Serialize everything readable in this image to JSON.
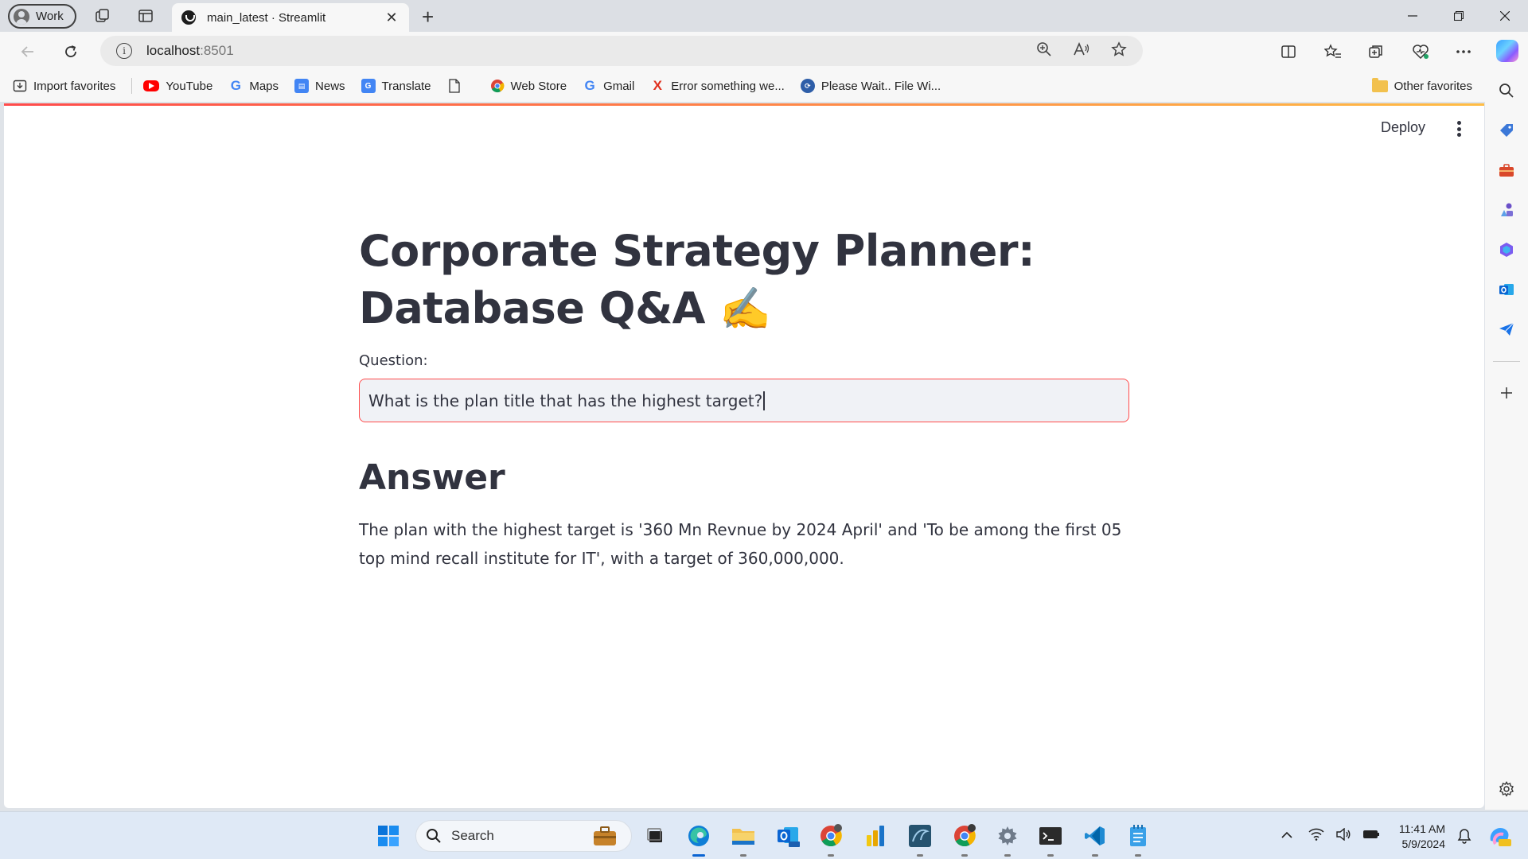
{
  "browser": {
    "profile_label": "Work",
    "tab_title": "main_latest · Streamlit",
    "tab_close": "✕",
    "new_tab": "+",
    "url_host": "localhost",
    "url_port": ":8501"
  },
  "favorites": {
    "items": [
      {
        "label": "Import favorites"
      },
      {
        "label": "YouTube"
      },
      {
        "label": "Maps"
      },
      {
        "label": "News"
      },
      {
        "label": "Translate"
      },
      {
        "label": ""
      },
      {
        "label": "Web Store"
      },
      {
        "label": "Gmail"
      },
      {
        "label": "Error something we..."
      },
      {
        "label": "Please Wait.. File Wi..."
      }
    ],
    "other": "Other favorites"
  },
  "app": {
    "deploy_label": "Deploy",
    "title_line1": "Corporate Strategy Planner:",
    "title_line2": "Database Q&A",
    "title_emoji": "✍️",
    "question_label": "Question:",
    "question_value": "What is the plan title that has the highest target?",
    "answer_heading": "Answer",
    "answer_text": "The plan with the highest target is '360 Mn Revnue by 2024 April' and 'To be among the first 05 top mind recall institute for IT', with a target of 360,000,000."
  },
  "taskbar": {
    "search_placeholder": "Search",
    "time": "11:41 AM",
    "date": "5/9/2024"
  },
  "colors": {
    "accent": "#ff4b4b",
    "text": "#31333f",
    "input_bg": "#f0f2f6"
  }
}
